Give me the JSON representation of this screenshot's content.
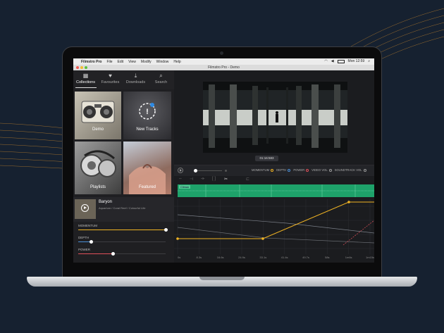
{
  "menubar": {
    "app": "Filmstro Pro",
    "items": [
      "File",
      "Edit",
      "View",
      "Modify",
      "Window",
      "Help"
    ],
    "clock": "Mon 12:59"
  },
  "window": {
    "title": "Filmstro Pro - Demo"
  },
  "nav": {
    "tabs": [
      {
        "label": "Collections",
        "icon": "grid-icon"
      },
      {
        "label": "Favourites",
        "icon": "heart-icon"
      },
      {
        "label": "Downloads",
        "icon": "download-icon"
      },
      {
        "label": "Search",
        "icon": "search-icon"
      }
    ],
    "active": "Collections"
  },
  "tiles": [
    {
      "label": "Demo"
    },
    {
      "label": "New Tracks",
      "badge": "!"
    },
    {
      "label": "Playlists"
    },
    {
      "label": "Featured"
    }
  ],
  "now_playing": {
    "title": "Baryon",
    "subtitle": "Aquarium / Coral Reef / Colourful Life"
  },
  "sliders": [
    {
      "label": "MOMENTUM",
      "value": 1.0,
      "color": "#f0b323"
    },
    {
      "label": "DEPTH",
      "value": 0.15,
      "color": "#4a8fd8"
    },
    {
      "label": "POWER",
      "value": 0.4,
      "color": "#e0505a"
    }
  ],
  "player": {
    "timecode": "01:16:583",
    "scrub": 0.0,
    "legend": [
      {
        "label": "MOMENTUM",
        "color": "#f0b323"
      },
      {
        "label": "DEPTH",
        "color": "#4a8fd8"
      },
      {
        "label": "POWER",
        "color": "#e0505a"
      },
      {
        "label": "VIDEO VOL",
        "color": "#9a9a9a"
      },
      {
        "label": "SOUNDTRACK VOL",
        "color": "#9a9a9a"
      }
    ]
  },
  "region": {
    "label": "Climax"
  },
  "timeline": {
    "ticks": [
      "0s",
      "8.3s",
      "16.6s",
      "24.9s",
      "33.1s",
      "41.4s",
      "49.7s",
      "58s",
      "1m6s",
      "1m15s"
    ]
  },
  "colors": {
    "accent": "#f0b323",
    "track_green": "#1ea26a"
  }
}
